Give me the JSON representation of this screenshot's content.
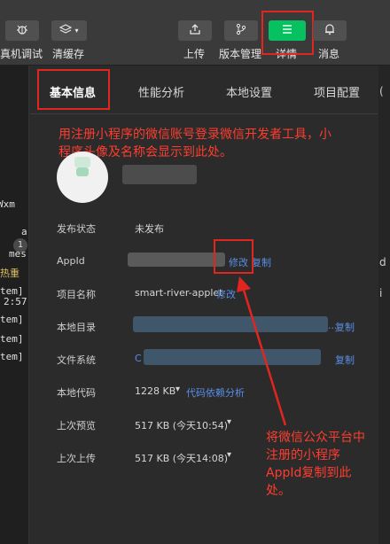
{
  "toolbar": {
    "items": [
      {
        "label": "真机调试",
        "icon": "bug-icon"
      },
      {
        "label": "清缓存",
        "icon": "layers-icon"
      },
      {
        "label": "上传",
        "icon": "upload-icon"
      },
      {
        "label": "版本管理",
        "icon": "branch-icon"
      },
      {
        "label": "详情",
        "icon": "menu-icon"
      },
      {
        "label": "消息",
        "icon": "bell-icon"
      }
    ]
  },
  "tabs": [
    "基本信息",
    "性能分析",
    "本地设置",
    "项目配置"
  ],
  "annotations": {
    "top_note": "用注册小程序的微信账号登录微信开发者工具，小程序头像及名称会显示到此处。",
    "bottom_note": "将微信公众平台中注册的小程序AppId复制到此处。",
    "color": "#e0261f"
  },
  "info": {
    "publish_status": {
      "label": "发布状态",
      "value": "未发布"
    },
    "appid": {
      "label": "AppId",
      "edit": "修改",
      "copy": "复制"
    },
    "project_name": {
      "label": "项目名称",
      "value": "smart-river-applet",
      "edit": "修改"
    },
    "local_dir": {
      "label": "本地目录",
      "suffix": "...",
      "copy": "复制"
    },
    "file_system": {
      "label": "文件系统",
      "prefix": "C",
      "copy": "复制"
    },
    "local_code": {
      "label": "本地代码",
      "value": "1228 KB",
      "link": "代码依赖分析"
    },
    "last_preview": {
      "label": "上次预览",
      "value": "517 KB (今天10:54)"
    },
    "last_upload": {
      "label": "上次上传",
      "value": "517 KB (今天14:08)"
    }
  },
  "left_strip": {
    "badge": "1",
    "lines": [
      "Wxm",
      "a",
      "mes",
      "热重",
      "tem]",
      "2:57",
      "tem]",
      "tem]",
      "tem]"
    ]
  },
  "right_strip": {
    "lines": [
      "(",
      "d",
      "i"
    ]
  },
  "colors": {
    "accent_green": "#07c160",
    "link_blue": "#5a8ee6"
  }
}
